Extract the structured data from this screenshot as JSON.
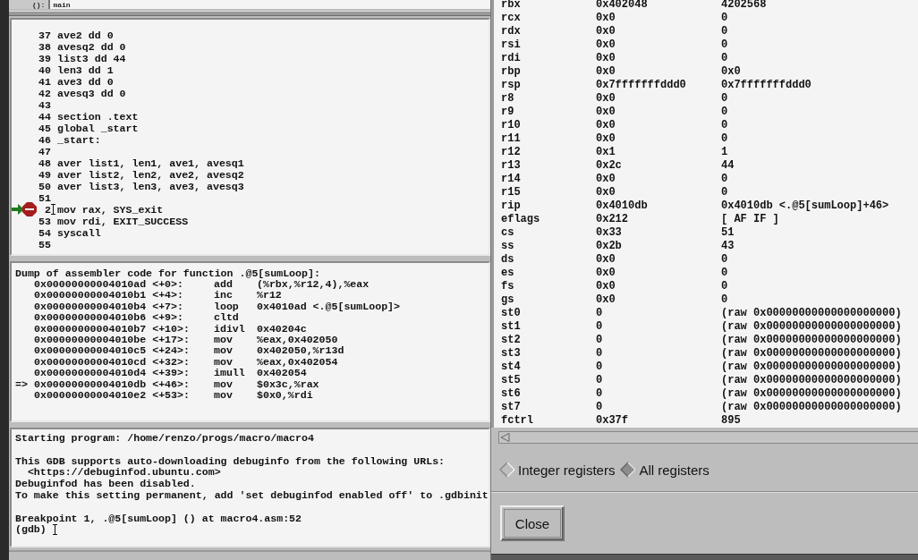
{
  "header": {
    "label": "():",
    "value": "main"
  },
  "source": {
    "lines": [
      {
        "number": "37",
        "code": "ave2 dd 0"
      },
      {
        "number": "38",
        "code": "avesq2 dd 0"
      },
      {
        "number": "39",
        "code": "list3 dd 44"
      },
      {
        "number": "40",
        "code": "len3 dd 1"
      },
      {
        "number": "41",
        "code": "ave3 dd 0"
      },
      {
        "number": "42",
        "code": "avesq3 dd 0"
      },
      {
        "number": "43"
      },
      {
        "number": "44",
        "code": "section .text"
      },
      {
        "number": "45",
        "code": "global _start"
      },
      {
        "number": "46",
        "code": "_start:"
      },
      {
        "number": "47"
      },
      {
        "number": "48",
        "code": "aver list1, len1, ave1, avesq1"
      },
      {
        "number": "49",
        "code": "aver list2, len2, ave2, avesq2"
      },
      {
        "number": "50",
        "code": "aver list3, len3, ave3, avesq3"
      },
      {
        "number": "51"
      },
      {
        "number": "2",
        "code": "mov rax, SYS_exit",
        "breakpoint": true,
        "current": true
      },
      {
        "number": "53",
        "code": "mov rdi, EXIT_SUCCESS"
      },
      {
        "number": "54",
        "code": "syscall"
      },
      {
        "number": "55"
      }
    ]
  },
  "disassembly": {
    "header": "Dump of assembler code for function .@5[sumLoop]:",
    "rows": [
      {
        "location": "0x00000000004010ad <+0>:",
        "mnemonic": "add",
        "operands": "(%rbx,%r12,4),%eax"
      },
      {
        "location": "0x00000000004010b1 <+4>:",
        "mnemonic": "inc",
        "operands": "%r12"
      },
      {
        "location": "0x00000000004010b4 <+7>:",
        "mnemonic": "loop",
        "operands": "0x4010ad <.@5[sumLoop]>"
      },
      {
        "location": "0x00000000004010b6 <+9>:",
        "mnemonic": "cltd"
      },
      {
        "location": "0x00000000004010b7 <+10>:",
        "mnemonic": "idivl",
        "operands": "0x40204c"
      },
      {
        "location": "0x00000000004010be <+17>:",
        "mnemonic": "mov",
        "operands": "%eax,0x402050"
      },
      {
        "location": "0x00000000004010c5 <+24>:",
        "mnemonic": "mov",
        "operands": "0x402050,%r13d"
      },
      {
        "location": "0x00000000004010cd <+32>:",
        "mnemonic": "mov",
        "operands": "%eax,0x402054"
      },
      {
        "location": "0x00000000004010d4 <+39>:",
        "mnemonic": "imull",
        "operands": "0x402054"
      },
      {
        "marker": "=>",
        "location": "0x00000000004010db <+46>:",
        "mnemonic": "mov",
        "operands": "$0x3c,%rax"
      },
      {
        "location": "0x00000000004010e2 <+53>:",
        "mnemonic": "mov",
        "operands": "$0x0,%rdi"
      }
    ]
  },
  "console": {
    "lines": [
      {
        "text": "Starting program: /home/renzo/progs/macro/macro4"
      },
      {
        "text": "This GDB supports auto-downloading debuginfo from the following URLs:",
        "space_before": true
      },
      {
        "text": "  <https://debuginfod.ubuntu.com>"
      },
      {
        "text": "Debuginfod has been disabled."
      },
      {
        "text": "To make this setting permanent, add 'set debuginfod enabled off' to .gdbinit"
      },
      {
        "text": "Breakpoint 1, .@5[sumLoop] () at macro4.asm:52",
        "space_before": true
      }
    ],
    "prompt": "(gdb)"
  },
  "registers": {
    "rows": [
      [
        "rbx",
        "0x402048",
        "4202568"
      ],
      [
        "rcx",
        "0x0",
        "0"
      ],
      [
        "rdx",
        "0x0",
        "0"
      ],
      [
        "rsi",
        "0x0",
        "0"
      ],
      [
        "rdi",
        "0x0",
        "0"
      ],
      [
        "rbp",
        "0x0",
        "0x0"
      ],
      [
        "rsp",
        "0x7fffffffddd0",
        "0x7fffffffddd0"
      ],
      [
        "r8",
        "0x0",
        "0"
      ],
      [
        "r9",
        "0x0",
        "0"
      ],
      [
        "r10",
        "0x0",
        "0"
      ],
      [
        "r11",
        "0x0",
        "0"
      ],
      [
        "r12",
        "0x1",
        "1"
      ],
      [
        "r13",
        "0x2c",
        "44"
      ],
      [
        "r14",
        "0x0",
        "0"
      ],
      [
        "r15",
        "0x0",
        "0"
      ],
      [
        "rip",
        "0x4010db",
        "0x4010db <.@5[sumLoop]+46>"
      ],
      [
        "eflags",
        "0x212",
        "[ AF IF ]"
      ],
      [
        "cs",
        "0x33",
        "51"
      ],
      [
        "ss",
        "0x2b",
        "43"
      ],
      [
        "ds",
        "0x0",
        "0"
      ],
      [
        "es",
        "0x0",
        "0"
      ],
      [
        "fs",
        "0x0",
        "0"
      ],
      [
        "gs",
        "0x0",
        "0"
      ],
      [
        "st0",
        "0",
        "(raw 0x00000000000000000000)"
      ],
      [
        "st1",
        "0",
        "(raw 0x00000000000000000000)"
      ],
      [
        "st2",
        "0",
        "(raw 0x00000000000000000000)"
      ],
      [
        "st3",
        "0",
        "(raw 0x00000000000000000000)"
      ],
      [
        "st4",
        "0",
        "(raw 0x00000000000000000000)"
      ],
      [
        "st5",
        "0",
        "(raw 0x00000000000000000000)"
      ],
      [
        "st6",
        "0",
        "(raw 0x00000000000000000000)"
      ],
      [
        "st7",
        "0",
        "(raw 0x00000000000000000000)"
      ],
      [
        "fctrl",
        "0x37f",
        "895"
      ]
    ],
    "views": [
      {
        "label": "Integer registers",
        "selected": false
      },
      {
        "label": "All registers",
        "selected": true
      }
    ],
    "button": "Close"
  }
}
